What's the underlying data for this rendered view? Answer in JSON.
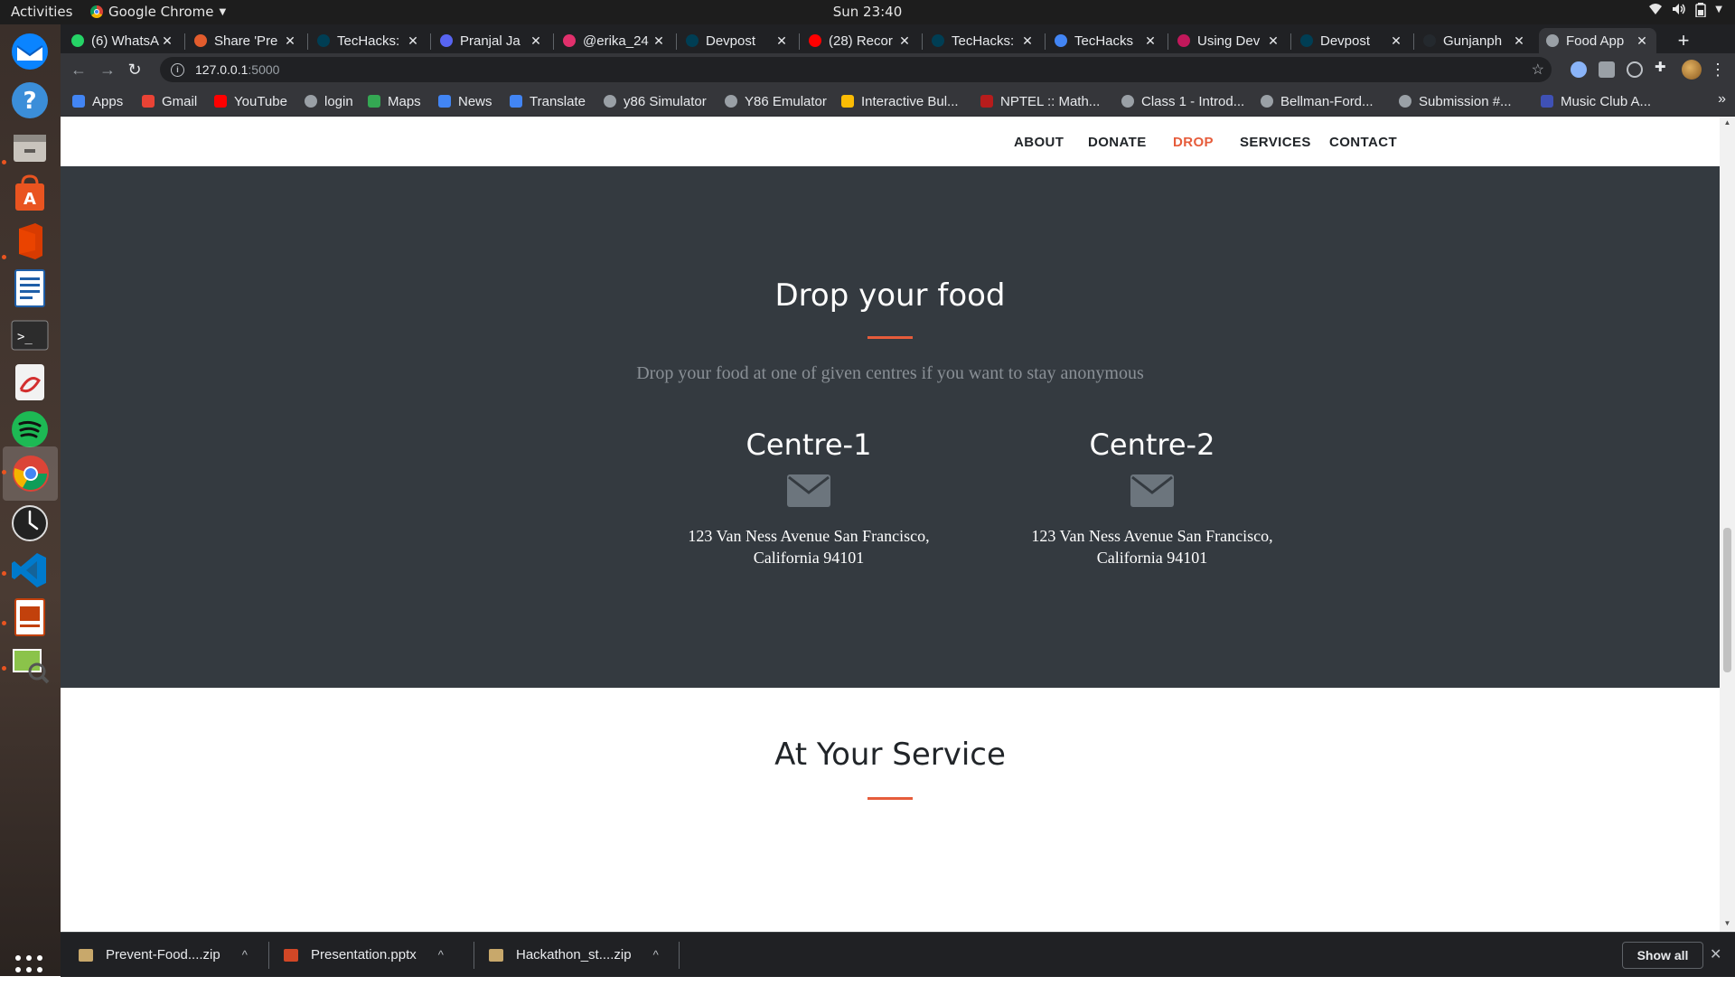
{
  "system": {
    "activities": "Activities",
    "app_menu": "Google Chrome",
    "clock": "Sun 23:40"
  },
  "tabs": [
    {
      "title": "(6) WhatsA",
      "favicon": "whatsapp-icon",
      "color": "#25d366"
    },
    {
      "title": "Share 'Pre",
      "favicon": "p-icon",
      "color": "#e25c2d"
    },
    {
      "title": "TecHacks:",
      "favicon": "devpost-icon",
      "color": "#003e54"
    },
    {
      "title": "Pranjal Ja",
      "favicon": "discord-icon",
      "color": "#5865f2"
    },
    {
      "title": "@erika_24",
      "favicon": "instagram-icon",
      "color": "#e1306c"
    },
    {
      "title": "Devpost",
      "favicon": "devpost-icon",
      "color": "#003e54"
    },
    {
      "title": "(28) Recor",
      "favicon": "youtube-icon",
      "color": "#ff0000"
    },
    {
      "title": "TecHacks:",
      "favicon": "devpost-icon",
      "color": "#003e54"
    },
    {
      "title": "TecHacks",
      "favicon": "docs-icon",
      "color": "#4285f4"
    },
    {
      "title": "Using Dev",
      "favicon": "dev-icon",
      "color": "#c2185b"
    },
    {
      "title": "Devpost",
      "favicon": "devpost-icon",
      "color": "#003e54"
    },
    {
      "title": "Gunjanph",
      "favicon": "github-icon",
      "color": "#24292e"
    },
    {
      "title": "Food App",
      "favicon": "globe-icon",
      "color": "#9aa0a6",
      "active": true
    }
  ],
  "omnibox": {
    "host": "127.0.0.1",
    "port": ":5000"
  },
  "bookmarks": [
    {
      "label": "Apps",
      "icon": "apps-grid-icon",
      "color": "#4285f4"
    },
    {
      "label": "Gmail",
      "icon": "gmail-icon",
      "color": "#ea4335"
    },
    {
      "label": "YouTube",
      "icon": "youtube-icon",
      "color": "#ff0000"
    },
    {
      "label": "login",
      "icon": "globe-icon",
      "color": "#9aa0a6"
    },
    {
      "label": "Maps",
      "icon": "maps-icon",
      "color": "#34a853"
    },
    {
      "label": "News",
      "icon": "news-icon",
      "color": "#4285f4"
    },
    {
      "label": "Translate",
      "icon": "translate-icon",
      "color": "#4285f4"
    },
    {
      "label": "y86 Simulator",
      "icon": "globe-icon",
      "color": "#9aa0a6"
    },
    {
      "label": "Y86 Emulator",
      "icon": "globe-icon",
      "color": "#9aa0a6"
    },
    {
      "label": "Interactive Bul...",
      "icon": "chart-icon",
      "color": "#fbbc04"
    },
    {
      "label": "NPTEL :: Math...",
      "icon": "nptel-icon",
      "color": "#b71c1c"
    },
    {
      "label": "Class 1 - Introd...",
      "icon": "globe-icon",
      "color": "#9aa0a6"
    },
    {
      "label": "Bellman-Ford...",
      "icon": "globe-icon",
      "color": "#9aa0a6"
    },
    {
      "label": "Submission #...",
      "icon": "globe-icon",
      "color": "#9aa0a6"
    },
    {
      "label": "Music Club A...",
      "icon": "w3-icon",
      "color": "#3f51b5"
    }
  ],
  "site": {
    "nav": [
      "ABOUT",
      "DONATE",
      "DROP",
      "SERVICES",
      "CONTACT"
    ],
    "active_nav": "DROP",
    "drop": {
      "title": "Drop your food",
      "subtitle": "Drop your food at one of given centres if you want to stay anonymous",
      "centres": [
        {
          "name": "Centre-1",
          "address_line1": "123 Van Ness Avenue San Francisco,",
          "address_line2": "California 94101"
        },
        {
          "name": "Centre-2",
          "address_line1": "123 Van Ness Avenue San Francisco,",
          "address_line2": "California 94101"
        }
      ]
    },
    "service": {
      "title": "At Your Service"
    }
  },
  "downloads": [
    {
      "name": "Prevent-Food....zip",
      "icon": "zip-file-icon",
      "color": "#c8a86b"
    },
    {
      "name": "Presentation.pptx",
      "icon": "pptx-file-icon",
      "color": "#d24726"
    },
    {
      "name": "Hackathon_st....zip",
      "icon": "zip-file-icon",
      "color": "#c8a86b"
    }
  ],
  "shelf": {
    "show_all": "Show all"
  },
  "colors": {
    "accent": "#e65c3b",
    "section_dark": "#343a40",
    "envelope": "#6c757d"
  }
}
